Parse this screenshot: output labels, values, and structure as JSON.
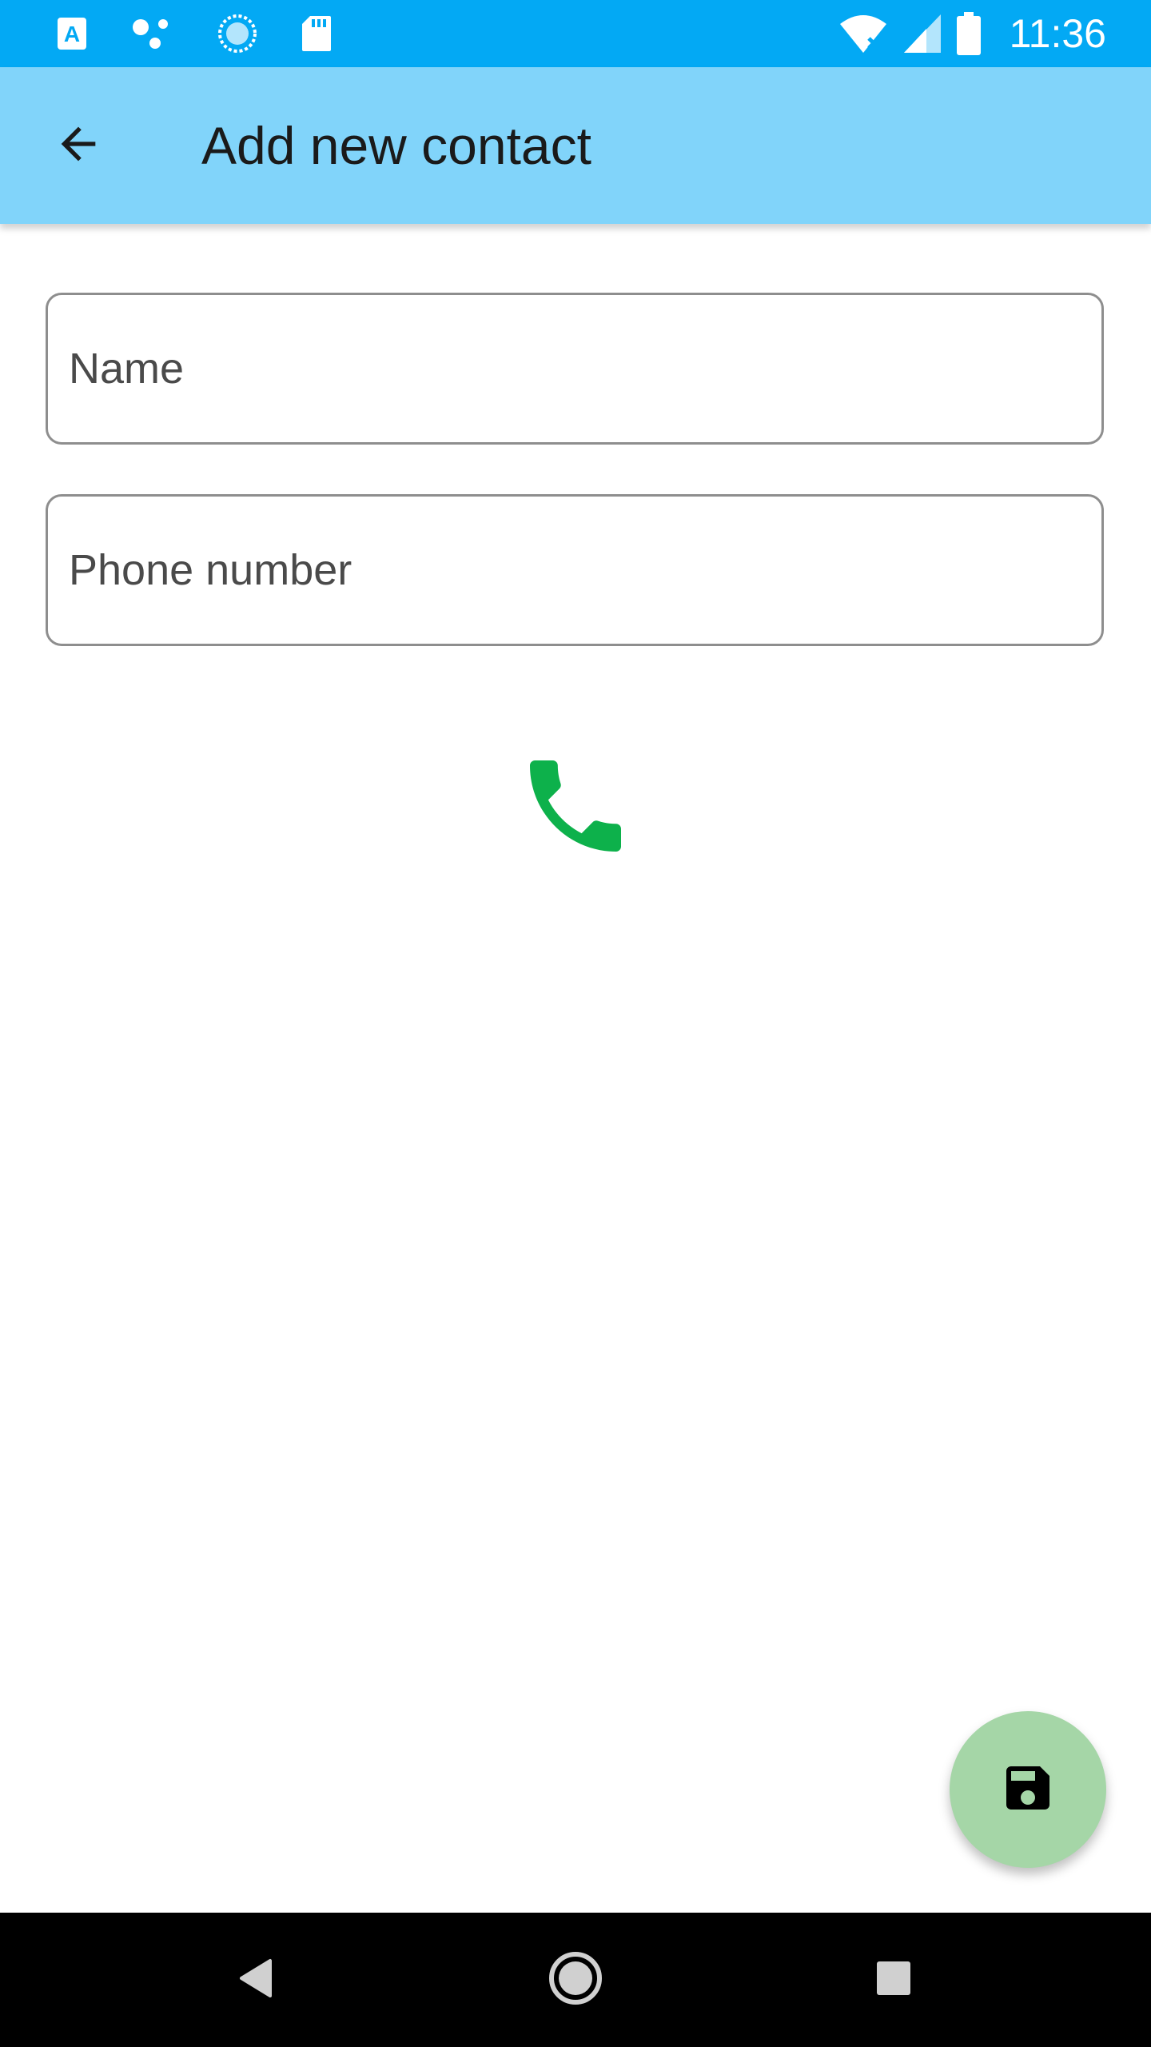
{
  "status_bar": {
    "time": "11:36",
    "left_icons": [
      "a-notification-icon",
      "dots-notification-icon",
      "sync-notification-icon",
      "sd-card-icon"
    ],
    "right_icons": [
      "wifi-off-icon",
      "signal-icon",
      "battery-icon"
    ],
    "color": "#03a9f4"
  },
  "app_bar": {
    "title": "Add new contact",
    "back_icon": "arrow-back-icon",
    "color": "#81d4fa"
  },
  "form": {
    "name_placeholder": "Name",
    "name_value": "",
    "phone_placeholder": "Phone number",
    "phone_value": ""
  },
  "call_button": {
    "icon": "phone-icon",
    "color": "#0db14b"
  },
  "fab": {
    "icon": "save-icon",
    "color": "#a5d6a7"
  },
  "nav_bar": {
    "buttons": [
      "back-icon",
      "home-icon",
      "recents-icon"
    ]
  }
}
